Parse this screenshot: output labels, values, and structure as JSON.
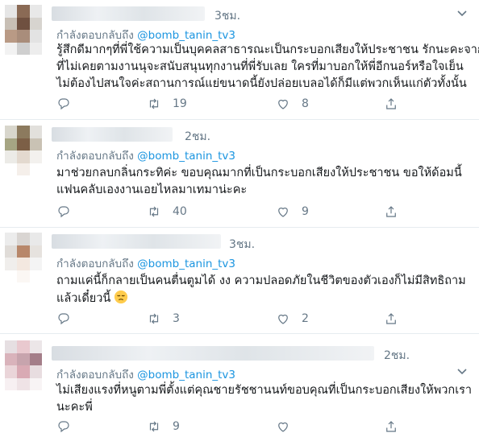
{
  "tweets": [
    {
      "time": "3ชม.",
      "replying_prefix": "กำลังตอบกลับถึง",
      "handle": "@bomb_tanin_tv3",
      "lines": [
        "รู้สึกดีมากๆที่พี่ใช้ความเป็นบุคคลสาธารณะเป็นกระบอกเสียงให้ประชาชน รักนะคะจาก",
        "ที่ไม่เคยตามงานนุจะสนับสนุนทุกงานที่พี่รับเลย ใครที่มาบอกให้พี่อีกนอร์หรือใจเย็น",
        "ไม่ต้องไปสนใจค่ะสถานการณ์แย่ขนาดนี้ยังปล่อยเบลอได้ก็มีแต่พวกเห็นแก่ตัวทั้งนั้น"
      ],
      "retweets": "19",
      "likes": "8"
    },
    {
      "time": "2ชม.",
      "replying_prefix": "กำลังตอบกลับถึง",
      "handle": "@bomb_tanin_tv3",
      "lines": [
        "มาช่วยกลบกลิ่นกระทิค่ะ ขอบคุณมากที่เป็นกระบอกเสียงให้ประชาชน ขอให้ด้อมนี้",
        "แฟนคลับเองงานเอยไหลมาเทมาน่ะคะ"
      ],
      "retweets": "40",
      "likes": "9"
    },
    {
      "time": "3ชม.",
      "replying_prefix": "กำลังตอบกลับถึง",
      "handle": "@bomb_tanin_tv3",
      "lines": [
        "ถามแค่นี้ก็กลายเป็นคนตื่นตูมได้ งง ความปลอดภัยในชีวิตของตัวเองก็ไม่มีสิทธิถาม",
        "แล้วเดี๋ยวนี้"
      ],
      "emoji": "pensive-face",
      "retweets": "3",
      "likes": "2"
    },
    {
      "time": "2ชม.",
      "replying_prefix": "กำลังตอบกลับถึง",
      "handle": "@bomb_tanin_tv3",
      "lines": [
        "ไม่เสียงแรงที่หนูตามพี่ตั้งแต่คุณชายรัชชานนท์ขอบคุณที่เป็นกระบอกเสียงให้พวกเรา",
        "นะคะพี่"
      ],
      "retweets": "9",
      "likes": ""
    }
  ],
  "colors": {
    "handle": "#1b95e0",
    "muted": "#657786",
    "text": "#14171a",
    "divider": "#e6ecf0"
  },
  "icons": {
    "reply": "reply-icon",
    "retweet": "retweet-icon",
    "like": "heart-icon",
    "share": "share-icon",
    "menu": "chevron-down-icon"
  }
}
